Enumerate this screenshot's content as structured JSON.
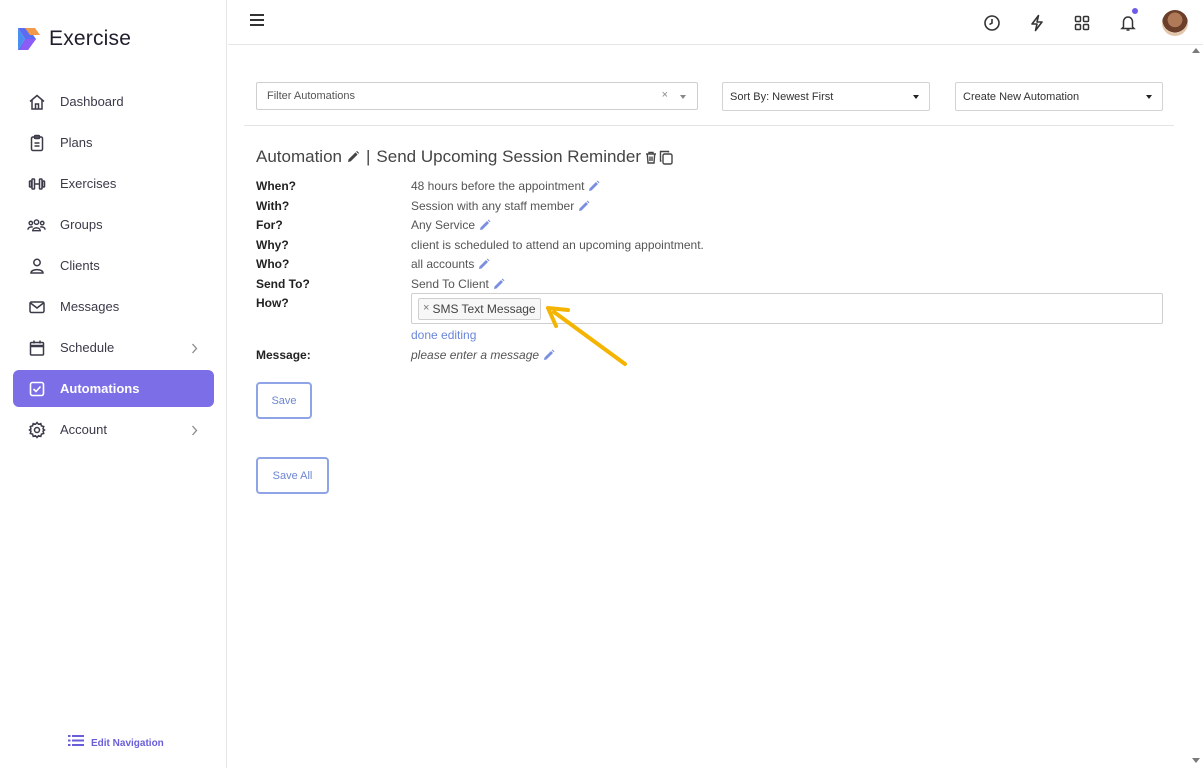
{
  "app": {
    "name": "Exercise"
  },
  "sidebar": {
    "items": [
      {
        "label": "Dashboard",
        "icon": "home-icon"
      },
      {
        "label": "Plans",
        "icon": "clipboard-icon"
      },
      {
        "label": "Exercises",
        "icon": "dumbbell-icon"
      },
      {
        "label": "Groups",
        "icon": "users-icon"
      },
      {
        "label": "Clients",
        "icon": "user-icon"
      },
      {
        "label": "Messages",
        "icon": "envelope-icon"
      },
      {
        "label": "Schedule",
        "icon": "calendar-icon"
      },
      {
        "label": "Automations",
        "icon": "check-square-icon",
        "active": true
      },
      {
        "label": "Account",
        "icon": "gear-icon"
      }
    ],
    "edit_nav_label": "Edit Navigation"
  },
  "toolbar": {
    "filter_placeholder": "Filter Automations",
    "filter_clear": "×",
    "sort_label": "Sort By: Newest First",
    "create_label": "Create New Automation"
  },
  "automation": {
    "heading": "Automation",
    "separator": "|",
    "name": "Send Upcoming Session Reminder",
    "fields": {
      "when_label": "When?",
      "when_value": "48 hours before the appointment",
      "with_label": "With?",
      "with_value": "Session with any staff member",
      "for_label": "For?",
      "for_value": "Any Service",
      "why_label": "Why?",
      "why_value": "client is scheduled to attend an upcoming appointment.",
      "who_label": "Who?",
      "who_value": "all accounts",
      "sendto_label": "Send To?",
      "sendto_value": "Send To Client",
      "how_label": "How?",
      "how_tag": "SMS Text Message",
      "how_tag_remove": "×",
      "done_editing": "done editing",
      "message_label": "Message:",
      "message_value": "please enter a message"
    },
    "save_label": "Save",
    "save_all_label": "Save All"
  },
  "colors": {
    "accent": "#7c6ee6",
    "link": "#6a86d8",
    "pencil": "#7b8fe0",
    "arrow": "#f4b400"
  }
}
